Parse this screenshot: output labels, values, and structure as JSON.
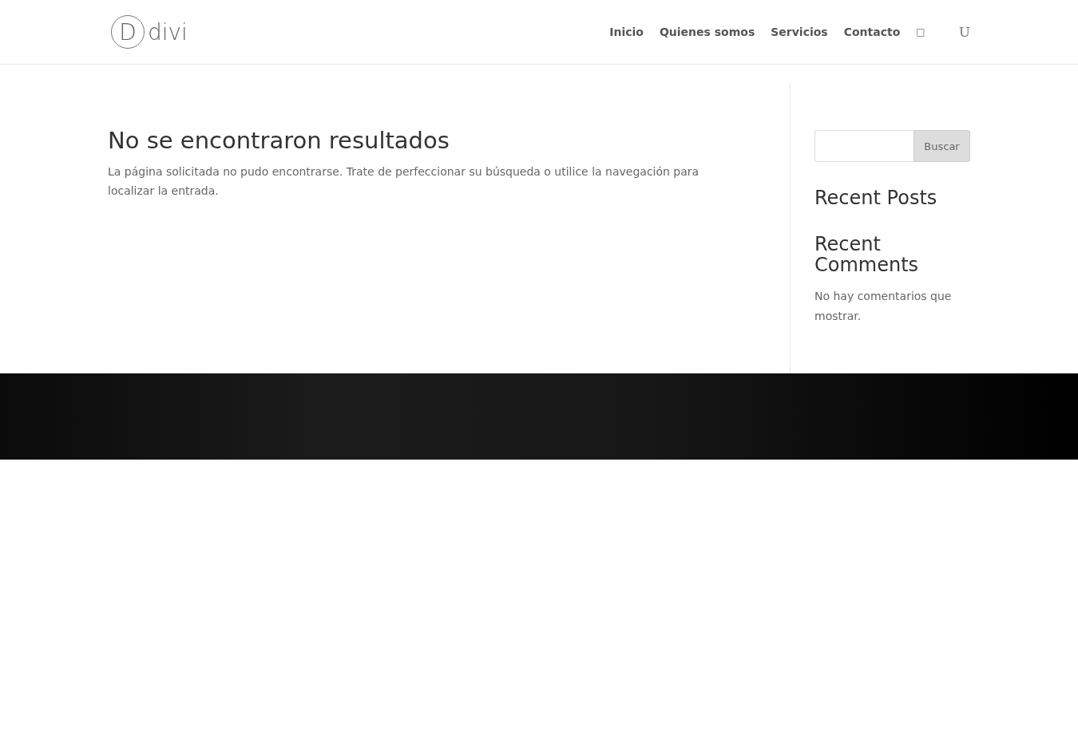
{
  "header": {
    "logo": {
      "letter": "D",
      "name": "divi"
    },
    "nav": [
      {
        "label": "Inicio"
      },
      {
        "label": "Quienes somos"
      },
      {
        "label": "Servicios"
      },
      {
        "label": "Contacto"
      }
    ],
    "icons": [
      "□",
      "U"
    ]
  },
  "main": {
    "title": "No se encontraron resultados",
    "text": "La página solicitada no pudo encontrarse. Trate de perfeccionar su búsqueda o utilice la navegación para localizar la entrada."
  },
  "sidebar": {
    "search": {
      "button": "Buscar"
    },
    "widgets": [
      {
        "title": "Recent Posts"
      },
      {
        "title": "Recent Comments",
        "text": "No hay comentarios que mostrar."
      }
    ]
  }
}
